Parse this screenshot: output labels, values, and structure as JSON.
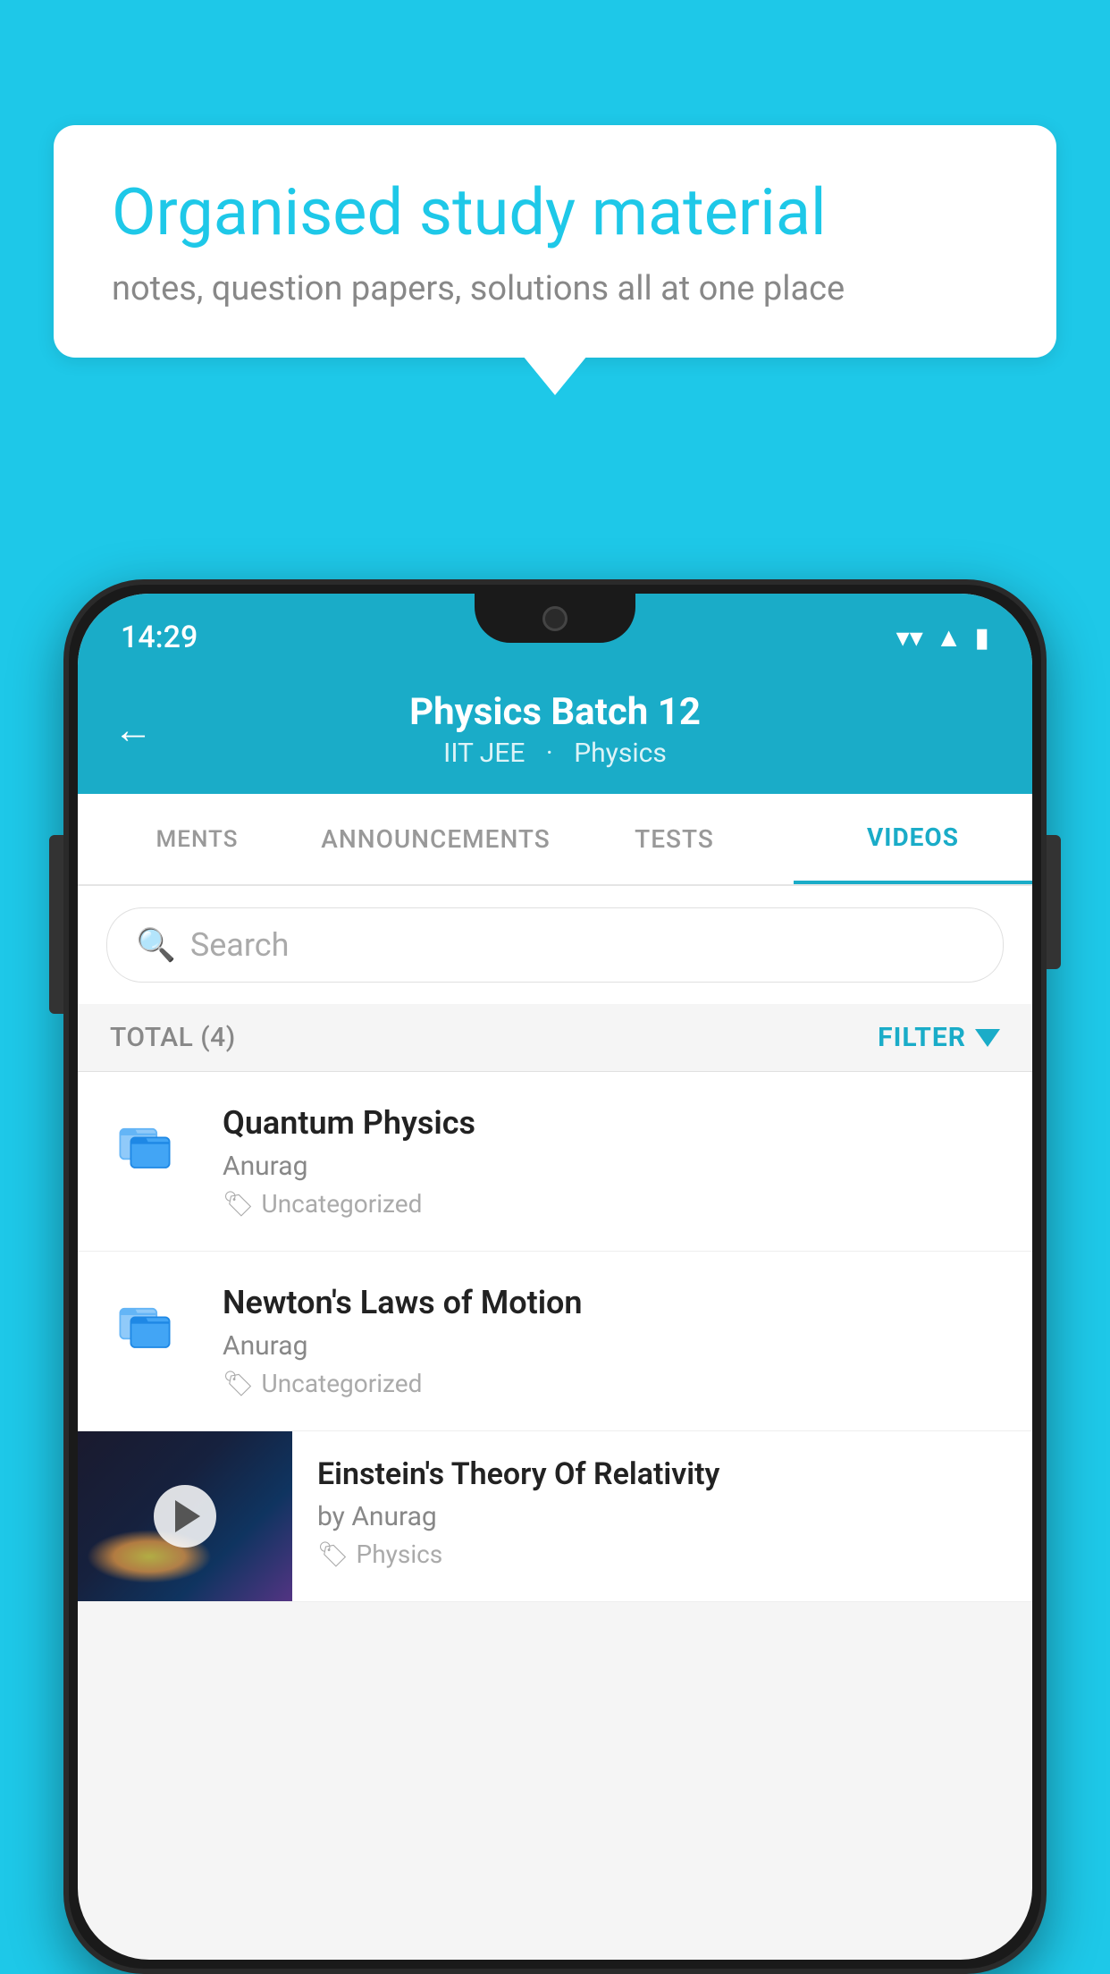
{
  "background_color": "#1EC8E8",
  "speech_bubble": {
    "heading": "Organised study material",
    "subtext": "notes, question papers, solutions all at one place"
  },
  "phone": {
    "status_bar": {
      "time": "14:29",
      "icons": [
        "wifi",
        "signal",
        "battery"
      ]
    },
    "header": {
      "back_label": "←",
      "title": "Physics Batch 12",
      "subtitle_part1": "IIT JEE",
      "subtitle_part2": "Physics"
    },
    "tabs": [
      {
        "label": "MENTS",
        "active": false
      },
      {
        "label": "ANNOUNCEMENTS",
        "active": false
      },
      {
        "label": "TESTS",
        "active": false
      },
      {
        "label": "VIDEOS",
        "active": true
      }
    ],
    "search": {
      "placeholder": "Search"
    },
    "filter_bar": {
      "total_label": "TOTAL (4)",
      "filter_label": "FILTER"
    },
    "videos": [
      {
        "id": 1,
        "title": "Quantum Physics",
        "author": "Anurag",
        "tag": "Uncategorized",
        "has_thumbnail": false
      },
      {
        "id": 2,
        "title": "Newton's Laws of Motion",
        "author": "Anurag",
        "tag": "Uncategorized",
        "has_thumbnail": false
      },
      {
        "id": 3,
        "title": "Einstein's Theory Of Relativity",
        "author": "by Anurag",
        "tag": "Physics",
        "has_thumbnail": true
      }
    ]
  }
}
